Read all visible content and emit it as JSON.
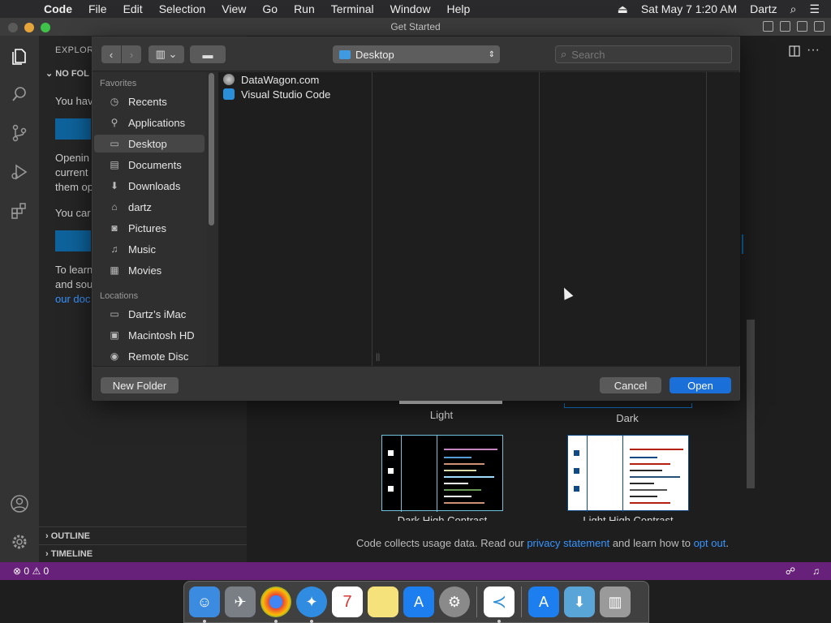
{
  "menubar": {
    "app": "Code",
    "items": [
      "File",
      "Edit",
      "Selection",
      "View",
      "Go",
      "Run",
      "Terminal",
      "Window",
      "Help"
    ],
    "datetime": "Sat May 7  1:20 AM",
    "user": "Dartz"
  },
  "window": {
    "title": "Get Started"
  },
  "sidebar": {
    "header": "EXPLOR",
    "section": "NO FOL",
    "text1": "You hav",
    "text2a": "Openin",
    "text2b": "current",
    "text2c": "them op",
    "text3": "You car",
    "text4a": "To learn",
    "text4b": "and sou",
    "text4c": "our doc",
    "outline": "OUTLINE",
    "timeline": "TIMELINE"
  },
  "dialog": {
    "location": "Desktop",
    "search_placeholder": "Search",
    "favorites_label": "Favorites",
    "favorites": [
      {
        "label": "Recents",
        "icon": "clock-icon"
      },
      {
        "label": "Applications",
        "icon": "applications-icon"
      },
      {
        "label": "Desktop",
        "icon": "desktop-icon"
      },
      {
        "label": "Documents",
        "icon": "documents-icon"
      },
      {
        "label": "Downloads",
        "icon": "downloads-icon"
      },
      {
        "label": "dartz",
        "icon": "home-icon"
      },
      {
        "label": "Pictures",
        "icon": "camera-icon"
      },
      {
        "label": "Music",
        "icon": "music-icon"
      },
      {
        "label": "Movies",
        "icon": "film-icon"
      }
    ],
    "locations_label": "Locations",
    "locations": [
      {
        "label": "Dartz’s iMac",
        "icon": "imac-icon"
      },
      {
        "label": "Macintosh HD",
        "icon": "harddrive-icon"
      },
      {
        "label": "Remote Disc",
        "icon": "disc-icon"
      }
    ],
    "files": [
      {
        "label": "DataWagon.com",
        "icon": "webloc-icon"
      },
      {
        "label": "Visual Studio Code",
        "icon": "vscode-icon"
      }
    ],
    "new_folder": "New Folder",
    "cancel": "Cancel",
    "open": "Open"
  },
  "themes": {
    "light": "Light",
    "dark": "Dark",
    "dark_hc": "Dark High Contrast",
    "light_hc": "Light High Contrast"
  },
  "privacy": {
    "prefix": "Code collects usage data. Read our",
    "link1": "privacy statement",
    "middle": "and learn how to",
    "link2": "opt out",
    "suffix": "."
  },
  "status": {
    "errors": "0",
    "warnings": "0"
  },
  "dock": [
    "finder-icon",
    "launchpad-icon",
    "chrome-icon",
    "safari-icon",
    "calendar-icon",
    "notes-icon",
    "appstore-icon",
    "system-preferences-icon",
    "vscode-icon",
    "applications-folder-icon",
    "downloads-folder-icon",
    "trash-icon"
  ],
  "colors": {
    "accent": "#0e639c",
    "statusbar": "#68217a",
    "open_button": "#1a6fd8",
    "link": "#3794ff"
  }
}
